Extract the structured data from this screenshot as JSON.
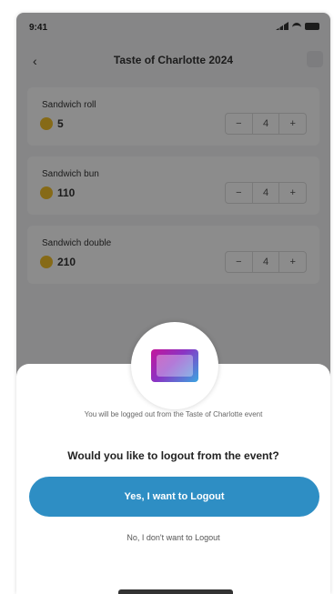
{
  "status_bar": {
    "time": "9:41"
  },
  "header": {
    "title": "Taste of Charlotte 2024"
  },
  "items": [
    {
      "label": "Sandwich roll",
      "value": "5",
      "stepper_value": "4"
    },
    {
      "label": "Sandwich bun",
      "value": "110",
      "stepper_value": "4"
    },
    {
      "label": "Sandwich double",
      "value": "210",
      "stepper_value": "4"
    }
  ],
  "modal": {
    "info": "You will be logged out from the Taste of Charlotte event",
    "question": "Would you like to logout from the event?",
    "yes_label": "Yes, I want to Logout",
    "no_label": "No, I don't want to Logout"
  },
  "colors": {
    "accent": "#2e8ec4",
    "overlay": "rgba(0,0,0,0.45)"
  }
}
